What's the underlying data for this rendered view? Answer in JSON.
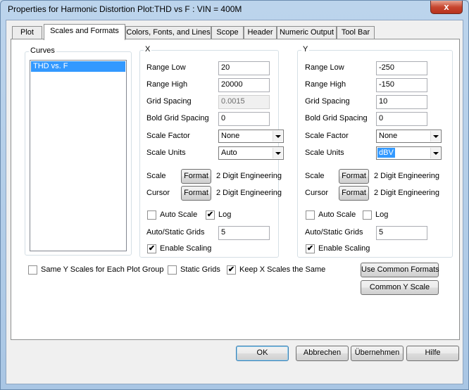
{
  "window": {
    "title": "Properties for Harmonic Distortion Plot:THD vs F : VIN = 400M",
    "close_symbol": "x"
  },
  "tabs": [
    {
      "label": "Plot",
      "active": false
    },
    {
      "label": "Scales and Formats",
      "active": true
    },
    {
      "label": "Colors, Fonts, and Lines",
      "active": false
    },
    {
      "label": "Scope",
      "active": false
    },
    {
      "label": "Header",
      "active": false
    },
    {
      "label": "Numeric Output",
      "active": false
    },
    {
      "label": "Tool Bar",
      "active": false
    }
  ],
  "curves": {
    "label": "Curves",
    "items": [
      "THD vs. F"
    ]
  },
  "x": {
    "group_label": "X",
    "range_low_label": "Range Low",
    "range_low": "20",
    "range_high_label": "Range High",
    "range_high": "20000",
    "grid_spacing_label": "Grid Spacing",
    "grid_spacing": "0.0015",
    "bold_grid_label": "Bold Grid Spacing",
    "bold_grid": "0",
    "scale_factor_label": "Scale Factor",
    "scale_factor": "None",
    "scale_units_label": "Scale Units",
    "scale_units": "Auto",
    "scale_label": "Scale",
    "scale_format_btn": "Format",
    "scale_format": "2 Digit Engineering",
    "cursor_label": "Cursor",
    "cursor_format_btn": "Format",
    "cursor_format": "2 Digit Engineering",
    "auto_scale_label": "Auto Scale",
    "auto_scale_checked": false,
    "log_label": "Log",
    "log_checked": true,
    "auto_static_label": "Auto/Static Grids",
    "auto_static": "5",
    "enable_scaling_label": "Enable Scaling",
    "enable_scaling_checked": true
  },
  "y": {
    "group_label": "Y",
    "range_low_label": "Range Low",
    "range_low": "-250",
    "range_high_label": "Range High",
    "range_high": "-150",
    "grid_spacing_label": "Grid Spacing",
    "grid_spacing": "10",
    "bold_grid_label": "Bold Grid Spacing",
    "bold_grid": "0",
    "scale_factor_label": "Scale Factor",
    "scale_factor": "None",
    "scale_units_label": "Scale Units",
    "scale_units": "dBV",
    "scale_label": "Scale",
    "scale_format_btn": "Format",
    "scale_format": "2 Digit Engineering",
    "cursor_label": "Cursor",
    "cursor_format_btn": "Format",
    "cursor_format": "2 Digit Engineering",
    "auto_scale_label": "Auto Scale",
    "auto_scale_checked": false,
    "log_label": "Log",
    "log_checked": false,
    "auto_static_label": "Auto/Static Grids",
    "auto_static": "5",
    "enable_scaling_label": "Enable Scaling",
    "enable_scaling_checked": true
  },
  "options": {
    "same_y_label": "Same Y Scales for Each Plot Group",
    "same_y_checked": false,
    "static_grids_label": "Static Grids",
    "static_grids_checked": false,
    "keep_x_label": "Keep X Scales the Same",
    "keep_x_checked": true,
    "use_common_formats": "Use Common Formats",
    "common_y_scale": "Common Y Scale"
  },
  "footer": {
    "ok": "OK",
    "cancel": "Abbrechen",
    "apply": "Übernehmen",
    "help": "Hilfe"
  },
  "check_mark": "✔"
}
